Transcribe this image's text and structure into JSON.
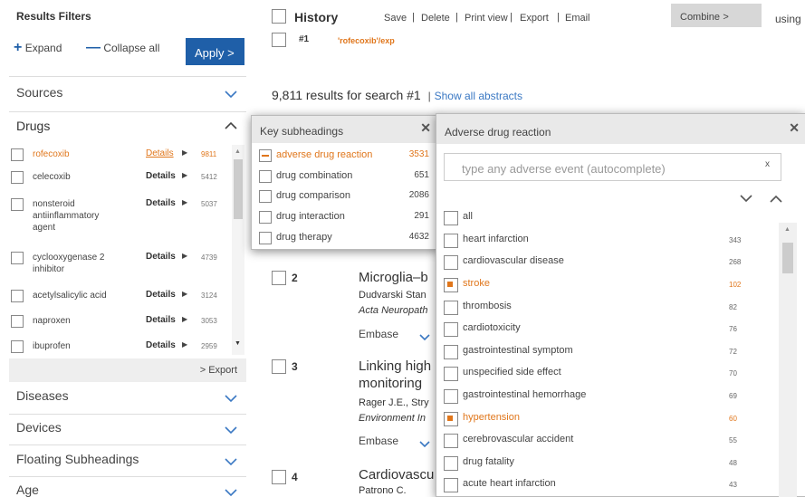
{
  "filters": {
    "title": "Results Filters",
    "expand": "Expand",
    "collapse": "Collapse all",
    "apply": "Apply"
  },
  "sections": {
    "sources": "Sources",
    "drugs": "Drugs",
    "diseases": "Diseases",
    "devices": "Devices",
    "floating": "Floating Subheadings",
    "age": "Age"
  },
  "drugs": [
    {
      "name": "rofecoxib",
      "details": "Details",
      "count": "9811"
    },
    {
      "name": "celecoxib",
      "details": "Details",
      "count": "5412"
    },
    {
      "name": "nonsteroid antiinflammatory agent",
      "details": "Details",
      "count": "5037"
    },
    {
      "name": "cyclooxygenase 2 inhibitor",
      "details": "Details",
      "count": "4739"
    },
    {
      "name": "acetylsalicylic acid",
      "details": "Details",
      "count": "3124"
    },
    {
      "name": "naproxen",
      "details": "Details",
      "count": "3053"
    },
    {
      "name": "ibuprofen",
      "details": "Details",
      "count": "2959"
    }
  ],
  "export": "Export",
  "history": {
    "title": "History",
    "save": "Save",
    "delete": "Delete",
    "print": "Print view",
    "export": "Export",
    "email": "Email",
    "combine": "Combine",
    "using": "using",
    "num": "#1",
    "query": "'rofecoxib'/exp"
  },
  "results": {
    "summary": "9,811 results for search #1",
    "show_abstracts": "Show all abstracts",
    "items": [
      {
        "num": "2",
        "title": "Microglia–b",
        "authors": "Dudvarski Stan",
        "source": "Acta Neuropath",
        "db": "Embase"
      },
      {
        "num": "3",
        "title": "Linking high",
        "title2": "monitoring",
        "authors": "Rager J.E., Stry",
        "source": "Environment In",
        "db": "Embase"
      },
      {
        "num": "4",
        "title": "Cardiovascu",
        "authors": "Patrono C."
      }
    ]
  },
  "key_sub": {
    "title": "Key subheadings",
    "items": [
      {
        "label": "adverse drug reaction",
        "count": "3531"
      },
      {
        "label": "drug combination",
        "count": "651"
      },
      {
        "label": "drug comparison",
        "count": "2086"
      },
      {
        "label": "drug interaction",
        "count": "291"
      },
      {
        "label": "drug therapy",
        "count": "4632"
      }
    ]
  },
  "adr": {
    "title": "Adverse drug reaction",
    "placeholder": "type any adverse event (autocomplete)",
    "clear": "x",
    "items": [
      {
        "label": "all",
        "count": ""
      },
      {
        "label": "heart infarction",
        "count": "343"
      },
      {
        "label": "cardiovascular disease",
        "count": "268"
      },
      {
        "label": "stroke",
        "count": "102"
      },
      {
        "label": "thrombosis",
        "count": "82"
      },
      {
        "label": "cardiotoxicity",
        "count": "76"
      },
      {
        "label": "gastrointestinal symptom",
        "count": "72"
      },
      {
        "label": "unspecified side effect",
        "count": "70"
      },
      {
        "label": "gastrointestinal hemorrhage",
        "count": "69"
      },
      {
        "label": "hypertension",
        "count": "60"
      },
      {
        "label": "cerebrovascular accident",
        "count": "55"
      },
      {
        "label": "drug fatality",
        "count": "48"
      },
      {
        "label": "acute heart infarction",
        "count": "43"
      }
    ]
  },
  "colors": {
    "accent": "#e0761b",
    "link": "#3a78c3",
    "apply": "#1f5fa8"
  }
}
